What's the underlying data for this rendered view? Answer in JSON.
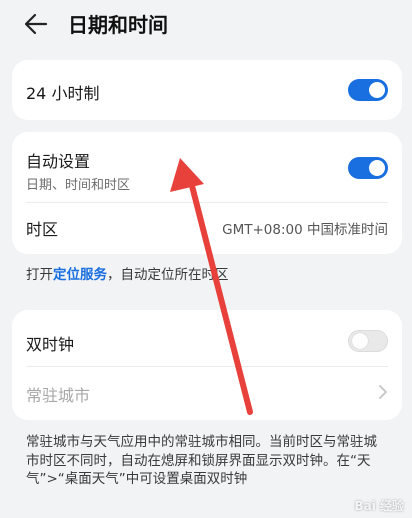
{
  "header": {
    "title": "日期和时间"
  },
  "card1": {
    "label_24h": "24 小时制",
    "toggle_24h": true
  },
  "card2": {
    "auto_title": "自动设置",
    "auto_sub": "日期、时间和时区",
    "auto_toggle": true,
    "timezone_label": "时区",
    "timezone_value": "GMT+08:00 中国标准时间"
  },
  "location_note": {
    "prefix": "打开",
    "link": "定位服务",
    "suffix": "，自动定位所在时区"
  },
  "card3": {
    "dual_clock_label": "双时钟",
    "dual_clock_toggle": false,
    "resident_city_label": "常驻城市"
  },
  "dual_clock_desc": "常驻城市与天气应用中的常驻城市相同。当前时区与常驻城市时区不同时，自动在熄屏和锁屏界面显示双时钟。在“天气”>“桌面天气”中可设置桌面双时钟",
  "watermark": "Bai 经验",
  "colors": {
    "accent": "#1a6fe0",
    "arrow": "#e8413c",
    "background": "#f1f3f5"
  }
}
